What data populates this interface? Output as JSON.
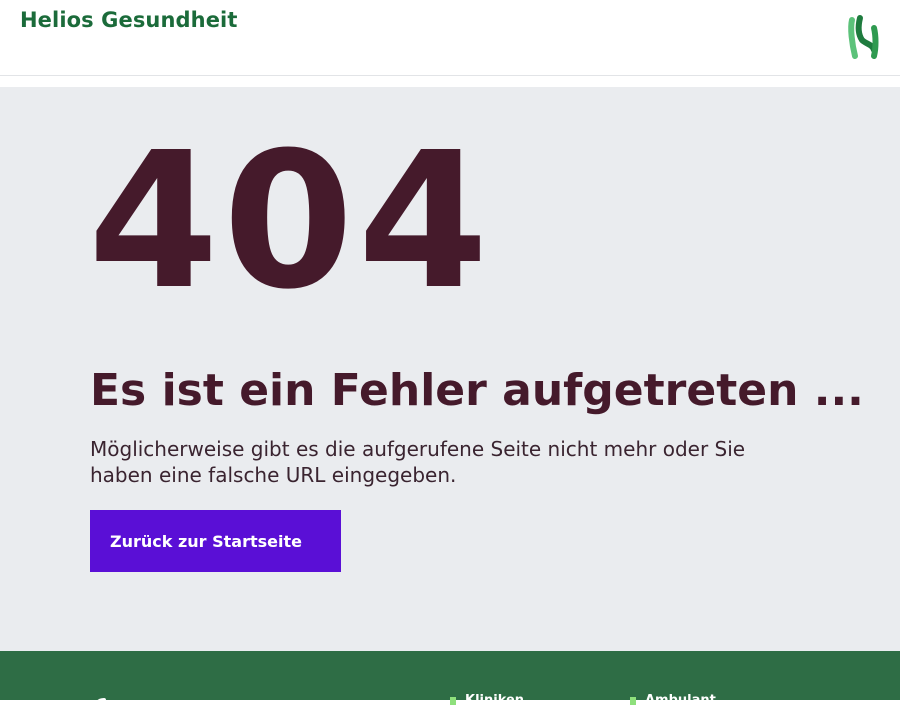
{
  "header": {
    "brand": "Helios Gesundheit",
    "logo_icon": "helios-h-logo-icon"
  },
  "error": {
    "code": "404",
    "headline": "Es ist ein Fehler aufgetreten ...",
    "message": "Möglicherweise gibt es die aufgerufene Seite nicht mehr oder Sie haben eine falsche URL eingegeben.",
    "back_button": "Zurück zur Startseite"
  },
  "footer": {
    "links": [
      "Kliniken",
      "Ambulant"
    ]
  },
  "colors": {
    "brand_green": "#1b6b3a",
    "heading_maroon": "#451a2b",
    "button_purple": "#5a0fd6",
    "footer_green": "#2e6d45",
    "page_gray": "#eaecef"
  }
}
